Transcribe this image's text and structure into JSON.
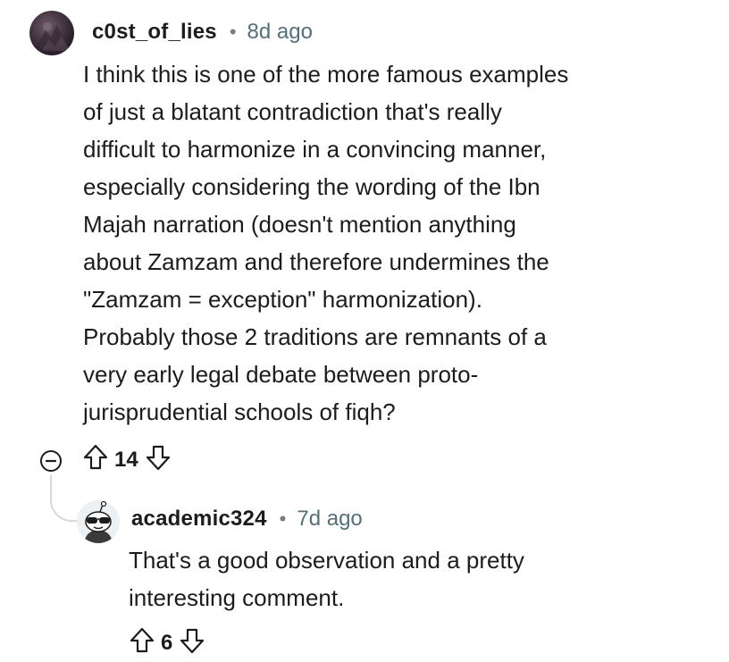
{
  "comment": {
    "username": "c0st_of_lies",
    "separator": "•",
    "time": "8d ago",
    "body_lines": [
      "I think this is one of the more famous examples",
      "of just a blatant contradiction that's really",
      "difficult to harmonize in a convincing manner,",
      "especially considering the wording of the Ibn",
      "Majah narration (doesn't mention anything",
      "about Zamzam and therefore undermines the",
      "\"Zamzam = exception\" harmonization).",
      "Probably those 2 traditions are remnants of a",
      "very early legal debate between proto-",
      "jurisprudential schools of fiqh?"
    ],
    "vote_count": "14"
  },
  "reply": {
    "username": "academic324",
    "separator": "•",
    "time": "7d ago",
    "body_lines": [
      "That's a good observation and a pretty",
      "interesting comment."
    ],
    "vote_count": "6"
  },
  "icons": {
    "upvote": "upvote-arrow-icon",
    "downvote": "downvote-arrow-icon",
    "collapse": "collapse-minus-icon"
  },
  "colors": {
    "text": "#1c1c1c",
    "meta": "#576f76",
    "thread_line": "#d6d9dc"
  }
}
